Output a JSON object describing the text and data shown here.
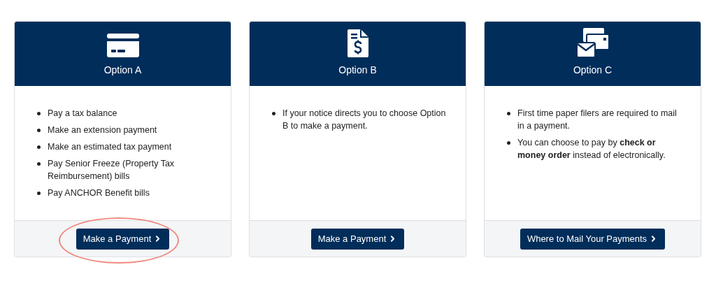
{
  "cards": [
    {
      "kind": "card",
      "title": "Option A",
      "bullets": [
        "Pay a tax balance",
        "Make an extension payment",
        "Make an estimated tax payment",
        "Pay Senior Freeze (Property Tax Reimbursement) bills",
        "Pay ANCHOR Benefit bills"
      ],
      "button": {
        "label": "Make a Payment",
        "highlighted": true
      }
    },
    {
      "kind": "invoice",
      "title": "Option B",
      "bullets": [
        "If your notice directs you to choose Option B to make a payment."
      ],
      "button": {
        "label": "Make a Payment",
        "highlighted": false
      }
    },
    {
      "kind": "mail",
      "title": "Option C",
      "bullets": [
        "First time paper filers are required to mail in a payment.",
        "You can choose to pay by **check or money order** instead of electronically."
      ],
      "button": {
        "label": "Where to Mail Your Payments",
        "highlighted": false
      }
    }
  ]
}
